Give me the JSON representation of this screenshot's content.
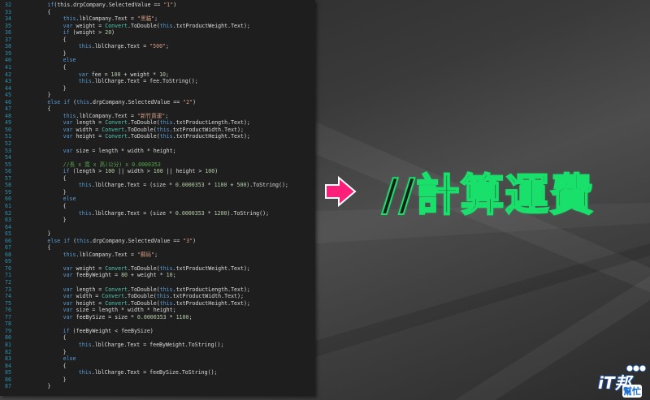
{
  "slide": {
    "title": "//計算運費",
    "colors": {
      "title_outline": "#19e06a",
      "arrow_fill": "#ff1f7a",
      "code_bg": "#1e1e1e"
    }
  },
  "logo": {
    "main": "iT邦",
    "sub": "幫忙",
    "icon": "it-help-logo-icon"
  },
  "code_lines": [
    {
      "ln": "32",
      "indent": 8,
      "tokens": [
        [
          "kw",
          "if"
        ],
        [
          "",
          "(this.drpCompany.SelectedValue == "
        ],
        [
          "str",
          "\"1\""
        ],
        [
          "",
          ")"
        ]
      ]
    },
    {
      "ln": "33",
      "indent": 8,
      "tokens": [
        [
          "",
          "{"
        ]
      ]
    },
    {
      "ln": "34",
      "indent": 12,
      "tokens": [
        [
          "kw",
          "this"
        ],
        [
          "",
          ".lblCompany.Text = "
        ],
        [
          "str",
          "\"黑貓\""
        ],
        [
          "",
          ";"
        ]
      ]
    },
    {
      "ln": "35",
      "indent": 12,
      "tokens": [
        [
          "kw",
          "var"
        ],
        [
          "",
          " weight = "
        ],
        [
          "type",
          "Convert"
        ],
        [
          "",
          ".ToDouble("
        ],
        [
          "kw",
          "this"
        ],
        [
          "",
          ".txtProductWeight.Text);"
        ]
      ]
    },
    {
      "ln": "36",
      "indent": 12,
      "tokens": [
        [
          "kw",
          "if"
        ],
        [
          "",
          " (weight > "
        ],
        [
          "num",
          "20"
        ],
        [
          "",
          ")"
        ]
      ]
    },
    {
      "ln": "37",
      "indent": 12,
      "tokens": [
        [
          "",
          "{"
        ]
      ]
    },
    {
      "ln": "38",
      "indent": 16,
      "tokens": [
        [
          "kw",
          "this"
        ],
        [
          "",
          ".lblCharge.Text = "
        ],
        [
          "str",
          "\"500\""
        ],
        [
          "",
          ";"
        ]
      ]
    },
    {
      "ln": "39",
      "indent": 12,
      "tokens": [
        [
          "",
          "}"
        ]
      ]
    },
    {
      "ln": "40",
      "indent": 12,
      "tokens": [
        [
          "kw",
          "else"
        ]
      ]
    },
    {
      "ln": "41",
      "indent": 12,
      "tokens": [
        [
          "",
          "{"
        ]
      ]
    },
    {
      "ln": "42",
      "indent": 16,
      "tokens": [
        [
          "kw",
          "var"
        ],
        [
          "",
          " fee = "
        ],
        [
          "num",
          "100"
        ],
        [
          "",
          " + weight * "
        ],
        [
          "num",
          "10"
        ],
        [
          "",
          ";"
        ]
      ]
    },
    {
      "ln": "43",
      "indent": 16,
      "tokens": [
        [
          "kw",
          "this"
        ],
        [
          "",
          ".lblCharge.Text = fee.ToString();"
        ]
      ]
    },
    {
      "ln": "44",
      "indent": 12,
      "tokens": [
        [
          "",
          "}"
        ]
      ]
    },
    {
      "ln": "45",
      "indent": 8,
      "tokens": [
        [
          "",
          "}"
        ]
      ]
    },
    {
      "ln": "46",
      "indent": 8,
      "tokens": [
        [
          "kw",
          "else if"
        ],
        [
          "",
          " ("
        ],
        [
          "kw",
          "this"
        ],
        [
          "",
          ".drpCompany.SelectedValue == "
        ],
        [
          "str",
          "\"2\""
        ],
        [
          "",
          ")"
        ]
      ]
    },
    {
      "ln": "47",
      "indent": 8,
      "tokens": [
        [
          "",
          "{"
        ]
      ]
    },
    {
      "ln": "48",
      "indent": 12,
      "tokens": [
        [
          "kw",
          "this"
        ],
        [
          "",
          ".lblCompany.Text = "
        ],
        [
          "str",
          "\"新竹貨運\""
        ],
        [
          "",
          ";"
        ]
      ]
    },
    {
      "ln": "49",
      "indent": 12,
      "tokens": [
        [
          "kw",
          "var"
        ],
        [
          "",
          " length = "
        ],
        [
          "type",
          "Convert"
        ],
        [
          "",
          ".ToDouble("
        ],
        [
          "kw",
          "this"
        ],
        [
          "",
          ".txtProductLength.Text);"
        ]
      ]
    },
    {
      "ln": "50",
      "indent": 12,
      "tokens": [
        [
          "kw",
          "var"
        ],
        [
          "",
          " width = "
        ],
        [
          "type",
          "Convert"
        ],
        [
          "",
          ".ToDouble("
        ],
        [
          "kw",
          "this"
        ],
        [
          "",
          ".txtProductWidth.Text);"
        ]
      ]
    },
    {
      "ln": "51",
      "indent": 12,
      "tokens": [
        [
          "kw",
          "var"
        ],
        [
          "",
          " height = "
        ],
        [
          "type",
          "Convert"
        ],
        [
          "",
          ".ToDouble("
        ],
        [
          "kw",
          "this"
        ],
        [
          "",
          ".txtProductHeight.Text);"
        ]
      ]
    },
    {
      "ln": "52",
      "indent": 12,
      "tokens": []
    },
    {
      "ln": "53",
      "indent": 12,
      "tokens": [
        [
          "kw",
          "var"
        ],
        [
          "",
          " size = length * width * height;"
        ]
      ]
    },
    {
      "ln": "54",
      "indent": 12,
      "tokens": []
    },
    {
      "ln": "55",
      "indent": 12,
      "tokens": [
        [
          "cmt",
          "//長 x 寬 x 高(公分) x 0.0000353"
        ]
      ]
    },
    {
      "ln": "56",
      "indent": 12,
      "tokens": [
        [
          "kw",
          "if"
        ],
        [
          "",
          " (length > "
        ],
        [
          "num",
          "100"
        ],
        [
          "",
          " || width > "
        ],
        [
          "num",
          "100"
        ],
        [
          "",
          " || height > "
        ],
        [
          "num",
          "100"
        ],
        [
          "",
          ")"
        ]
      ]
    },
    {
      "ln": "57",
      "indent": 12,
      "tokens": [
        [
          "",
          "{"
        ]
      ]
    },
    {
      "ln": "58",
      "indent": 16,
      "tokens": [
        [
          "kw",
          "this"
        ],
        [
          "",
          ".lblCharge.Text = (size * "
        ],
        [
          "num",
          "0.0000353"
        ],
        [
          "",
          " * "
        ],
        [
          "num",
          "1100"
        ],
        [
          "",
          " + "
        ],
        [
          "num",
          "500"
        ],
        [
          "",
          ").ToString();"
        ]
      ]
    },
    {
      "ln": "59",
      "indent": 12,
      "tokens": [
        [
          "",
          "}"
        ]
      ]
    },
    {
      "ln": "60",
      "indent": 12,
      "tokens": [
        [
          "kw",
          "else"
        ]
      ]
    },
    {
      "ln": "61",
      "indent": 12,
      "tokens": [
        [
          "",
          "{"
        ]
      ]
    },
    {
      "ln": "62",
      "indent": 16,
      "tokens": [
        [
          "kw",
          "this"
        ],
        [
          "",
          ".lblCharge.Text = (size * "
        ],
        [
          "num",
          "0.0000353"
        ],
        [
          "",
          " * "
        ],
        [
          "num",
          "1200"
        ],
        [
          "",
          ").ToString();"
        ]
      ]
    },
    {
      "ln": "63",
      "indent": 12,
      "tokens": [
        [
          "",
          "}"
        ]
      ]
    },
    {
      "ln": "64",
      "indent": 12,
      "tokens": []
    },
    {
      "ln": "65",
      "indent": 8,
      "tokens": [
        [
          "",
          "}"
        ]
      ]
    },
    {
      "ln": "66",
      "indent": 8,
      "tokens": [
        [
          "kw",
          "else if"
        ],
        [
          "",
          " ("
        ],
        [
          "kw",
          "this"
        ],
        [
          "",
          ".drpCompany.SelectedValue == "
        ],
        [
          "str",
          "\"3\""
        ],
        [
          "",
          ")"
        ]
      ]
    },
    {
      "ln": "67",
      "indent": 8,
      "tokens": [
        [
          "",
          "{"
        ]
      ]
    },
    {
      "ln": "68",
      "indent": 12,
      "tokens": [
        [
          "kw",
          "this"
        ],
        [
          "",
          ".lblCompany.Text = "
        ],
        [
          "str",
          "\"郵局\""
        ],
        [
          "",
          ";"
        ]
      ]
    },
    {
      "ln": "69",
      "indent": 12,
      "tokens": []
    },
    {
      "ln": "70",
      "indent": 12,
      "tokens": [
        [
          "kw",
          "var"
        ],
        [
          "",
          " weight = "
        ],
        [
          "type",
          "Convert"
        ],
        [
          "",
          ".ToDouble("
        ],
        [
          "kw",
          "this"
        ],
        [
          "",
          ".txtProductWeight.Text);"
        ]
      ]
    },
    {
      "ln": "71",
      "indent": 12,
      "tokens": [
        [
          "kw",
          "var"
        ],
        [
          "",
          " feeByWeight = "
        ],
        [
          "num",
          "80"
        ],
        [
          "",
          " + weight * "
        ],
        [
          "num",
          "10"
        ],
        [
          "",
          ";"
        ]
      ]
    },
    {
      "ln": "72",
      "indent": 12,
      "tokens": []
    },
    {
      "ln": "73",
      "indent": 12,
      "tokens": [
        [
          "kw",
          "var"
        ],
        [
          "",
          " length = "
        ],
        [
          "type",
          "Convert"
        ],
        [
          "",
          ".ToDouble("
        ],
        [
          "kw",
          "this"
        ],
        [
          "",
          ".txtProductLength.Text);"
        ]
      ]
    },
    {
      "ln": "74",
      "indent": 12,
      "tokens": [
        [
          "kw",
          "var"
        ],
        [
          "",
          " width = "
        ],
        [
          "type",
          "Convert"
        ],
        [
          "",
          ".ToDouble("
        ],
        [
          "kw",
          "this"
        ],
        [
          "",
          ".txtProductWidth.Text);"
        ]
      ]
    },
    {
      "ln": "75",
      "indent": 12,
      "tokens": [
        [
          "kw",
          "var"
        ],
        [
          "",
          " height = "
        ],
        [
          "type",
          "Convert"
        ],
        [
          "",
          ".ToDouble("
        ],
        [
          "kw",
          "this"
        ],
        [
          "",
          ".txtProductHeight.Text);"
        ]
      ]
    },
    {
      "ln": "76",
      "indent": 12,
      "tokens": [
        [
          "kw",
          "var"
        ],
        [
          "",
          " size = length * width * height;"
        ]
      ]
    },
    {
      "ln": "77",
      "indent": 12,
      "tokens": [
        [
          "kw",
          "var"
        ],
        [
          "",
          " feeBySize = size * "
        ],
        [
          "num",
          "0.0000353"
        ],
        [
          "",
          " * "
        ],
        [
          "num",
          "1100"
        ],
        [
          "",
          ";"
        ]
      ]
    },
    {
      "ln": "78",
      "indent": 12,
      "tokens": []
    },
    {
      "ln": "79",
      "indent": 12,
      "tokens": [
        [
          "kw",
          "if"
        ],
        [
          "",
          " (feeByWeight < feeBySize)"
        ]
      ]
    },
    {
      "ln": "80",
      "indent": 12,
      "tokens": [
        [
          "",
          "{"
        ]
      ]
    },
    {
      "ln": "81",
      "indent": 16,
      "tokens": [
        [
          "kw",
          "this"
        ],
        [
          "",
          ".lblCharge.Text = feeByWeight.ToString();"
        ]
      ]
    },
    {
      "ln": "82",
      "indent": 12,
      "tokens": [
        [
          "",
          "}"
        ]
      ]
    },
    {
      "ln": "83",
      "indent": 12,
      "tokens": [
        [
          "kw",
          "else"
        ]
      ]
    },
    {
      "ln": "84",
      "indent": 12,
      "tokens": [
        [
          "",
          "{"
        ]
      ]
    },
    {
      "ln": "85",
      "indent": 16,
      "tokens": [
        [
          "kw",
          "this"
        ],
        [
          "",
          ".lblCharge.Text = feeBySize.ToString();"
        ]
      ]
    },
    {
      "ln": "86",
      "indent": 12,
      "tokens": [
        [
          "",
          "}"
        ]
      ]
    },
    {
      "ln": "87",
      "indent": 8,
      "tokens": [
        [
          "",
          "}"
        ]
      ]
    }
  ]
}
